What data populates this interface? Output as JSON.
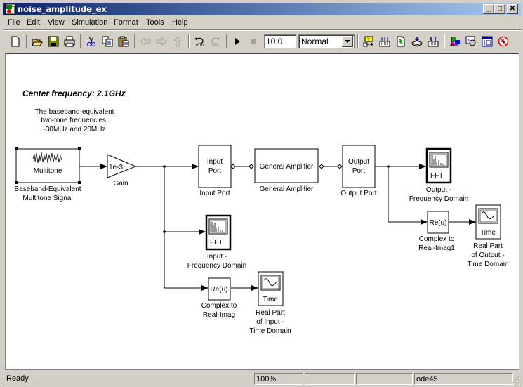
{
  "window": {
    "title": "noise_amplitude_ex",
    "controls": {
      "minimize": "_",
      "maximize": "□",
      "close": "✕"
    }
  },
  "menubar": {
    "items": [
      "File",
      "Edit",
      "View",
      "Simulation",
      "Format",
      "Tools",
      "Help"
    ]
  },
  "toolbar": {
    "buttons": [
      "new-model-icon",
      "open-icon",
      "save-icon",
      "print-icon",
      "cut-icon",
      "copy-icon",
      "paste-icon",
      "back-icon",
      "forward-icon",
      "up-icon",
      "undo-icon",
      "redo-icon",
      "start-simulation-icon",
      "stop-simulation-icon",
      "library-browser-icon",
      "toggle-model-browser-icon",
      "update-diagram-icon",
      "build-icon",
      "incremental-build-icon",
      "model-explorer-icon",
      "debugger-icon",
      "model-advisor-icon",
      "no-profiling-icon"
    ],
    "stop_time": "10.0",
    "sim_mode": "Normal"
  },
  "diagram": {
    "annotation_title": "Center frequency: 2.1GHz",
    "annotation_lines": [
      "The baseband-equivalent",
      "two-tone frequencies:",
      "-30MHz and 20MHz"
    ],
    "blocks": {
      "multitone": {
        "inner": "Multitone",
        "label_lines": [
          "Baseband-Equivalent",
          "Multitone Signal"
        ]
      },
      "gain": {
        "inner": "1e-3",
        "label": "Gain"
      },
      "input_port": {
        "inner_lines": [
          "Input",
          "Port"
        ],
        "label": "Input  Port"
      },
      "general_amplifier": {
        "inner": "General Amplifier",
        "label": "General Amplifier"
      },
      "output_port": {
        "inner_lines": [
          "Output",
          "Port"
        ],
        "label": "Output Port"
      },
      "output_fft": {
        "inner": "FFT",
        "label_lines": [
          "Output -",
          "Frequency Domain"
        ]
      },
      "complex_real_imag1": {
        "inner": "Re(u)",
        "label_lines": [
          "Complex to",
          "Real-Imag1"
        ]
      },
      "output_time": {
        "inner": "Time",
        "label_lines": [
          "Real Part",
          "of Output -",
          "Time Domain"
        ]
      },
      "input_fft": {
        "inner": "FFT",
        "label_lines": [
          "Input -",
          "Frequency Domain"
        ]
      },
      "complex_real_imag": {
        "inner": "Re(u)",
        "label_lines": [
          "Complex to",
          "Real-Imag"
        ]
      },
      "input_time": {
        "inner": "Time",
        "label_lines": [
          "Real Part",
          "of Input -",
          "Time Domain"
        ]
      }
    }
  },
  "statusbar": {
    "status": "Ready",
    "zoom": "100%",
    "field2": "",
    "field3": "",
    "solver": "ode45"
  }
}
